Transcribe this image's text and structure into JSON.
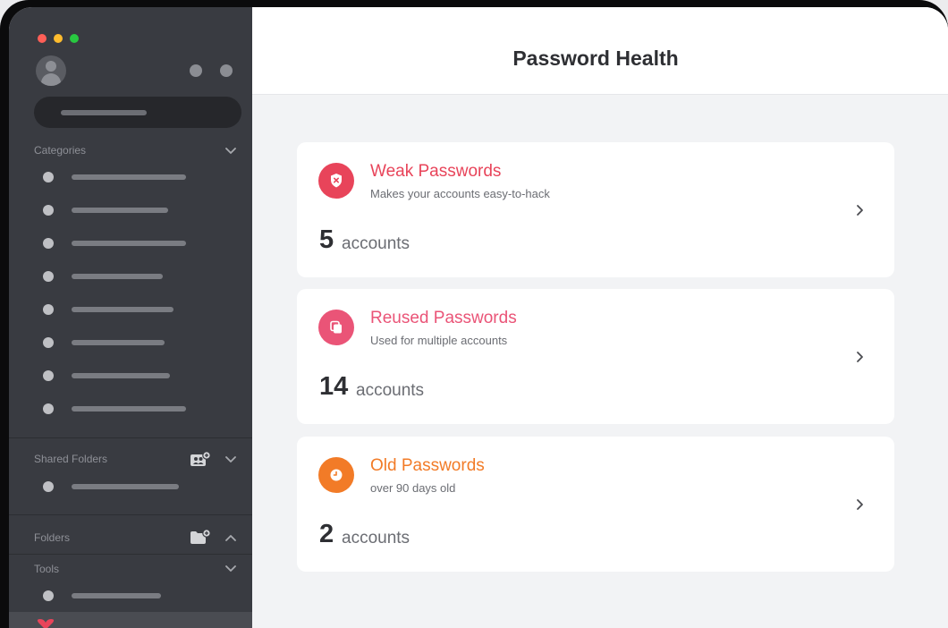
{
  "window": {
    "traffic_lights": [
      "close",
      "minimize",
      "zoom"
    ],
    "colors": {
      "close": "#ff5f57",
      "minimize": "#febc2e",
      "zoom": "#28c840"
    }
  },
  "sidebar": {
    "header_icons": [
      "avatar-icon",
      "dot-icon",
      "dot-icon"
    ],
    "sections": {
      "categories": {
        "label": "Categories",
        "state": "expanded",
        "item_count": 8
      },
      "shared_folders": {
        "label": "Shared Folders",
        "state": "expanded",
        "icon": "shared-folder-add-icon"
      },
      "folders": {
        "label": "Folders",
        "state": "collapsed",
        "icon": "folder-add-icon"
      },
      "tools": {
        "label": "Tools",
        "state": "expanded"
      }
    },
    "selected_icon": "heart-icon"
  },
  "main": {
    "title": "Password Health",
    "cards": [
      {
        "id": "weak",
        "title": "Weak Passwords",
        "subtitle": "Makes your accounts easy-to-hack",
        "count": "5",
        "unit": "accounts",
        "icon": "shield-x-icon",
        "color": "#e8445a"
      },
      {
        "id": "reused",
        "title": "Reused Passwords",
        "subtitle": "Used for multiple accounts",
        "count": "14",
        "unit": "accounts",
        "icon": "copy-icon",
        "color": "#ea5477"
      },
      {
        "id": "old",
        "title": "Old Passwords",
        "subtitle": "over 90 days old",
        "count": "2",
        "unit": "accounts",
        "icon": "clock-icon",
        "color": "#f27b27"
      }
    ]
  }
}
